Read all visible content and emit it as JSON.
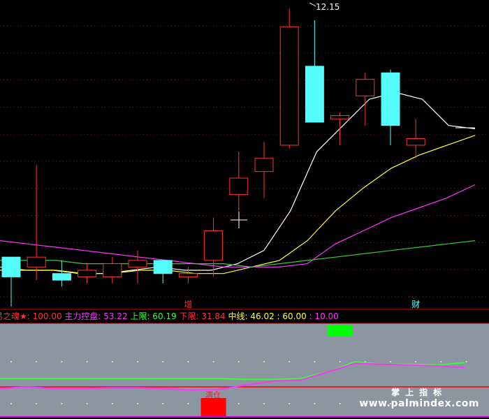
{
  "chart_data": [
    {
      "type": "candlestick",
      "title": "",
      "y_axis": "price",
      "ylim": [
        3.5,
        12.2
      ],
      "max_label": "12.15",
      "candles": [
        {
          "open": 4.6,
          "high": 4.6,
          "low": 3.1,
          "close": 4.0,
          "direction": "down"
        },
        {
          "open": 4.3,
          "high": 7.4,
          "low": 3.9,
          "close": 4.6,
          "direction": "up"
        },
        {
          "open": 4.1,
          "high": 4.5,
          "low": 3.7,
          "close": 3.9,
          "direction": "down"
        },
        {
          "open": 4.0,
          "high": 4.4,
          "low": 3.8,
          "close": 4.2,
          "direction": "up"
        },
        {
          "open": 4.0,
          "high": 4.6,
          "low": 3.8,
          "close": 4.4,
          "direction": "up"
        },
        {
          "open": 4.3,
          "high": 4.8,
          "low": 3.8,
          "close": 4.5,
          "direction": "up"
        },
        {
          "open": 4.1,
          "high": 4.2,
          "low": 3.8,
          "close": 4.5,
          "direction": "down"
        },
        {
          "open": 4.0,
          "high": 4.3,
          "low": 3.8,
          "close": 4.1,
          "direction": "up"
        },
        {
          "open": 4.5,
          "high": 5.8,
          "low": 4.0,
          "close": 5.4,
          "direction": "up"
        },
        {
          "open": 6.5,
          "high": 7.8,
          "low": 6.0,
          "close": 7.0,
          "direction": "up"
        },
        {
          "open": 7.2,
          "high": 8.1,
          "low": 6.4,
          "close": 7.6,
          "direction": "up"
        },
        {
          "open": 8.0,
          "high": 12.15,
          "low": 7.9,
          "close": 11.6,
          "direction": "up"
        },
        {
          "open": 10.4,
          "high": 11.8,
          "low": 9.0,
          "close": 8.7,
          "direction": "down"
        },
        {
          "open": 8.8,
          "high": 9.0,
          "low": 8.0,
          "close": 8.9,
          "direction": "up"
        },
        {
          "open": 9.5,
          "high": 10.2,
          "low": 8.6,
          "close": 10.0,
          "direction": "up"
        },
        {
          "open": 10.2,
          "high": 10.3,
          "low": 8.0,
          "close": 8.6,
          "direction": "down"
        },
        {
          "open": 8.0,
          "high": 8.8,
          "low": 7.6,
          "close": 8.2,
          "direction": "up"
        }
      ],
      "moving_averages": [
        {
          "color": "#ffffff",
          "values": [
            4.3,
            4.2,
            4.2,
            4.1,
            4.1,
            4.2,
            4.3,
            4.2,
            4.2,
            4.4,
            4.8,
            6.0,
            7.8,
            8.6,
            9.4,
            9.6,
            9.4,
            8.6,
            8.5
          ]
        },
        {
          "color": "#ffff33",
          "values": [
            4.2,
            4.2,
            4.2,
            4.1,
            4.1,
            4.2,
            4.2,
            4.1,
            4.1,
            4.3,
            4.5,
            5.1,
            6.0,
            6.7,
            7.3,
            7.7,
            8.0,
            8.3
          ]
        },
        {
          "color": "#ff33ff",
          "values": [
            5.1,
            5.0,
            4.9,
            4.8,
            4.7,
            4.6,
            4.5,
            4.4,
            4.3,
            4.3,
            4.3,
            4.4,
            5.0,
            5.4,
            5.8,
            6.1,
            6.4,
            6.8
          ]
        },
        {
          "color": "#33cc33",
          "values": [
            4.5,
            4.5,
            4.5,
            4.4,
            4.4,
            4.4,
            4.4,
            4.4,
            4.4,
            4.3,
            4.4,
            4.5,
            4.6,
            4.7,
            4.8,
            4.9,
            5.0,
            5.1
          ]
        }
      ],
      "signal_labels": [
        {
          "candle": 7,
          "text": "增",
          "color": "#ff3333"
        },
        {
          "candle": 16,
          "text": "财",
          "color": "#66ffff"
        }
      ]
    },
    {
      "type": "indicator",
      "title": "易之魂★",
      "legend": [
        {
          "label": "易之魂★:",
          "value": "100.00",
          "color": "#ff3333"
        },
        {
          "label": "主力控盘:",
          "value": "53.22",
          "color": "#ff33ff"
        },
        {
          "label": "上限:",
          "value": "60.19",
          "color": "#33ff33"
        },
        {
          "label": "下限:",
          "value": "31.84",
          "color": "#ff3333"
        },
        {
          "label": "中线:",
          "value": "46.02",
          "color": "#ffff33"
        },
        {
          "label": ":",
          "value": "60.00",
          "color": "#ffff33"
        },
        {
          "label": ":",
          "value": "10.00",
          "color": "#ff33ff"
        }
      ],
      "ylim": [
        0,
        100
      ],
      "series": [
        {
          "name": "上限",
          "color": "#33ff33",
          "values": [
            40,
            40,
            40,
            40,
            40,
            40,
            40,
            40,
            40,
            39,
            39,
            40,
            48,
            60,
            57,
            57,
            56,
            59
          ]
        },
        {
          "name": "主力控盘",
          "color": "#ff33ff",
          "values": [
            28,
            30,
            28,
            28,
            29,
            29,
            28,
            26,
            27,
            32,
            37,
            38,
            48,
            58,
            57,
            56,
            55,
            53
          ]
        }
      ],
      "bars": [
        {
          "candle": 8,
          "value": 100,
          "color": "#ff0000",
          "label": "满仓"
        },
        {
          "candle": 13,
          "value": 100,
          "color": "#00ff00",
          "label": ""
        }
      ],
      "watermark": {
        "line1": "掌上指标",
        "line2": "www.palmindex.com"
      }
    }
  ]
}
